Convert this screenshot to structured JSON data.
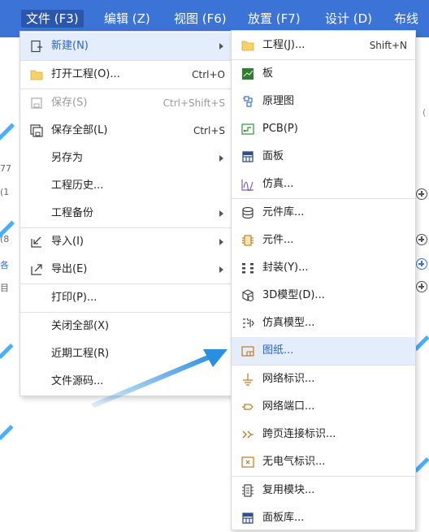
{
  "menubar": {
    "items": [
      {
        "label": "文件 (F3)"
      },
      {
        "label": "编辑 (Z)"
      },
      {
        "label": "视图 (F6)"
      },
      {
        "label": "放置 (F7)"
      },
      {
        "label": "设计 (D)"
      },
      {
        "label": "布线"
      }
    ]
  },
  "background": {
    "left_snippets": [
      "77",
      "(1",
      "(8",
      "各",
      "目"
    ],
    "right_snippet": "("
  },
  "file_menu": {
    "items": [
      {
        "label": "新建(N)",
        "shortcut": "",
        "submenu": true,
        "icon": "new-file-icon"
      },
      {
        "label": "打开工程(O)...",
        "shortcut": "Ctrl+O",
        "submenu": false,
        "icon": "folder-icon"
      },
      {
        "label": "保存(S)",
        "shortcut": "Ctrl+Shift+S",
        "submenu": false,
        "icon": "save-icon",
        "disabled": true
      },
      {
        "label": "保存全部(L)",
        "shortcut": "Ctrl+S",
        "submenu": false,
        "icon": "save-all-icon"
      },
      {
        "label": "另存为",
        "shortcut": "",
        "submenu": true,
        "icon": ""
      },
      {
        "label": "工程历史...",
        "shortcut": "",
        "submenu": false,
        "icon": ""
      },
      {
        "label": "工程备份",
        "shortcut": "",
        "submenu": true,
        "icon": ""
      },
      {
        "label": "导入(I)",
        "shortcut": "",
        "submenu": true,
        "icon": "import-icon"
      },
      {
        "label": "导出(E)",
        "shortcut": "",
        "submenu": true,
        "icon": "export-icon"
      },
      {
        "label": "打印(P)...",
        "shortcut": "",
        "submenu": false,
        "icon": ""
      },
      {
        "label": "关闭全部(X)",
        "shortcut": "",
        "submenu": false,
        "icon": ""
      },
      {
        "label": "近期工程(R)",
        "shortcut": "",
        "submenu": true,
        "icon": ""
      },
      {
        "label": "文件源码...",
        "shortcut": "",
        "submenu": false,
        "icon": ""
      }
    ]
  },
  "new_submenu": {
    "items": [
      {
        "label": "工程(J)...",
        "shortcut": "Shift+N",
        "icon": "folder-icon"
      },
      {
        "label": "板",
        "shortcut": "",
        "icon": "board-icon"
      },
      {
        "label": "原理图",
        "shortcut": "",
        "icon": "schematic-icon"
      },
      {
        "label": "PCB(P)",
        "shortcut": "",
        "icon": "pcb-icon"
      },
      {
        "label": "面板",
        "shortcut": "",
        "icon": "panel-icon"
      },
      {
        "label": "仿真...",
        "shortcut": "",
        "icon": "simulation-icon"
      },
      {
        "label": "元件库...",
        "shortcut": "",
        "icon": "library-icon"
      },
      {
        "label": "元件...",
        "shortcut": "",
        "icon": "component-icon"
      },
      {
        "label": "封装(Y)...",
        "shortcut": "",
        "icon": "footprint-icon"
      },
      {
        "label": "3D模型(D)...",
        "shortcut": "",
        "icon": "3d-model-icon"
      },
      {
        "label": "仿真模型...",
        "shortcut": "",
        "icon": "sim-model-icon"
      },
      {
        "label": "图纸...",
        "shortcut": "",
        "icon": "drawing-sheet-icon",
        "highlighted": true
      },
      {
        "label": "网络标识...",
        "shortcut": "",
        "icon": "net-label-icon"
      },
      {
        "label": "网络端口...",
        "shortcut": "",
        "icon": "net-port-icon"
      },
      {
        "label": "跨页连接标识...",
        "shortcut": "",
        "icon": "off-page-icon"
      },
      {
        "label": "无电气标识...",
        "shortcut": "",
        "icon": "no-connect-icon"
      },
      {
        "label": "复用模块...",
        "shortcut": "",
        "icon": "reuse-block-icon"
      },
      {
        "label": "面板库...",
        "shortcut": "",
        "icon": "panel-library-icon"
      }
    ]
  },
  "colors": {
    "menubar": "#3b73d6",
    "highlight_bg": "#e4edfb",
    "highlight_text": "#2b65c8",
    "annotation_arrow": "#2a8fe0"
  }
}
